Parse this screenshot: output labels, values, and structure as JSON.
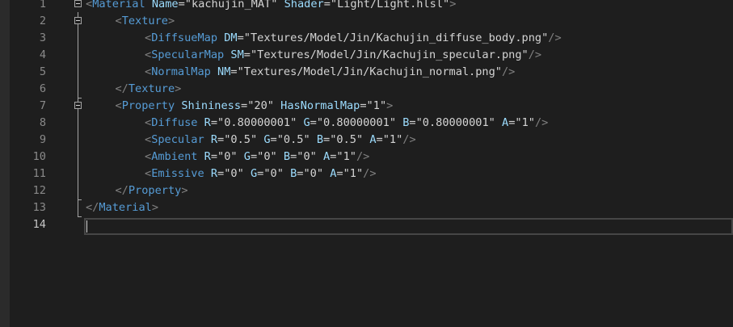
{
  "editor": {
    "current_line": "14",
    "lines": [
      {
        "num": "1",
        "indent": 0,
        "tag": "Material",
        "attrs": [
          {
            "name": "Name",
            "value": "kachujin_MAT"
          },
          {
            "name": "Shader",
            "value": "Light/Light.hlsl"
          }
        ],
        "close": ">"
      },
      {
        "num": "2",
        "indent": 1,
        "tag": "Texture",
        "attrs": [],
        "close": ">"
      },
      {
        "num": "3",
        "indent": 2,
        "tag": "DiffsueMap",
        "attrs": [
          {
            "name": "DM",
            "value": "Textures/Model/Jin/Kachujin_diffuse_body.png"
          }
        ],
        "close": "/>"
      },
      {
        "num": "4",
        "indent": 2,
        "tag": "SpecularMap",
        "attrs": [
          {
            "name": "SM",
            "value": "Textures/Model/Jin/Kachujin_specular.png"
          }
        ],
        "close": "/>"
      },
      {
        "num": "5",
        "indent": 2,
        "tag": "NormalMap",
        "attrs": [
          {
            "name": "NM",
            "value": "Textures/Model/Jin/Kachujin_normal.png"
          }
        ],
        "close": "/>"
      },
      {
        "num": "6",
        "indent": 1,
        "endtag": "Texture"
      },
      {
        "num": "7",
        "indent": 1,
        "tag": "Property",
        "attrs": [
          {
            "name": "Shininess",
            "value": "20"
          },
          {
            "name": "HasNormalMap",
            "value": "1"
          }
        ],
        "close": ">"
      },
      {
        "num": "8",
        "indent": 2,
        "tag": "Diffuse",
        "attrs": [
          {
            "name": "R",
            "value": "0.80000001"
          },
          {
            "name": "G",
            "value": "0.80000001"
          },
          {
            "name": "B",
            "value": "0.80000001"
          },
          {
            "name": "A",
            "value": "1"
          }
        ],
        "close": "/>"
      },
      {
        "num": "9",
        "indent": 2,
        "tag": "Specular",
        "attrs": [
          {
            "name": "R",
            "value": "0.5"
          },
          {
            "name": "G",
            "value": "0.5"
          },
          {
            "name": "B",
            "value": "0.5"
          },
          {
            "name": "A",
            "value": "1"
          }
        ],
        "close": "/>"
      },
      {
        "num": "10",
        "indent": 2,
        "tag": "Ambient",
        "attrs": [
          {
            "name": "R",
            "value": "0"
          },
          {
            "name": "G",
            "value": "0"
          },
          {
            "name": "B",
            "value": "0"
          },
          {
            "name": "A",
            "value": "1"
          }
        ],
        "close": "/>"
      },
      {
        "num": "11",
        "indent": 2,
        "tag": "Emissive",
        "attrs": [
          {
            "name": "R",
            "value": "0"
          },
          {
            "name": "G",
            "value": "0"
          },
          {
            "name": "B",
            "value": "0"
          },
          {
            "name": "A",
            "value": "1"
          }
        ],
        "close": "/>"
      },
      {
        "num": "12",
        "indent": 1,
        "endtag": "Property"
      },
      {
        "num": "13",
        "indent": 0,
        "endtag": "Material"
      },
      {
        "num": "14",
        "indent": 0
      }
    ],
    "colors": {
      "background": "#1e1e1e",
      "tag": "#569cd6",
      "attribute": "#9cdcfe",
      "punctuation": "#808080",
      "text": "#d4d4d4",
      "line_number": "#8a8a8a"
    }
  }
}
